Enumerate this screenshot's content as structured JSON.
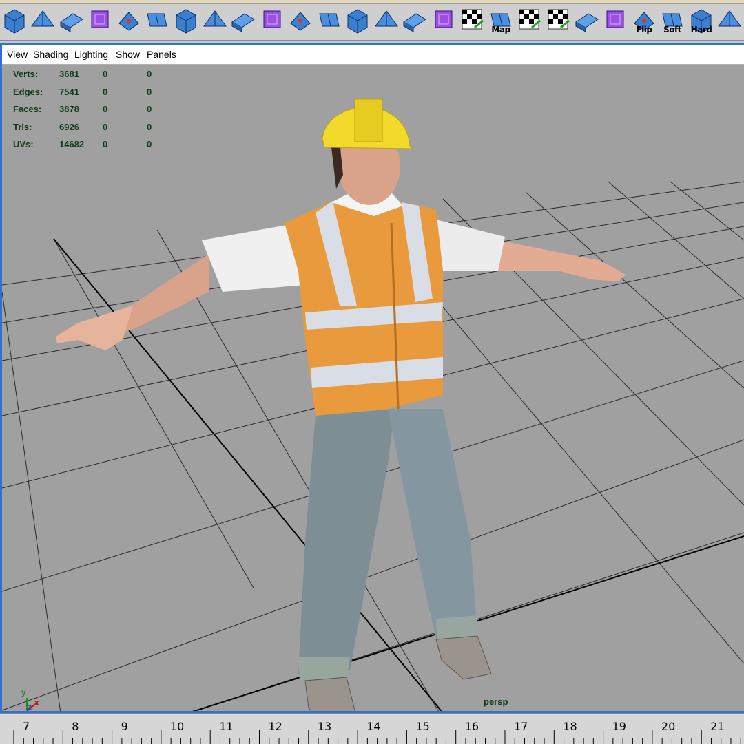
{
  "shelf": {
    "tools": [
      {
        "icon": "poly-cube-icon",
        "label": ""
      },
      {
        "icon": "poly-cube-select-icon",
        "label": ""
      },
      {
        "icon": "poly-cube-wire-icon",
        "label": ""
      },
      {
        "icon": "plane-pyramid-icon",
        "label": ""
      },
      {
        "icon": "select-face-icon",
        "label": ""
      },
      {
        "icon": "extrude-face-icon",
        "label": ""
      },
      {
        "icon": "bevel-icon",
        "label": ""
      },
      {
        "icon": "wedge-icon",
        "label": ""
      },
      {
        "icon": "split-face-icon",
        "label": ""
      },
      {
        "icon": "smooth-icon",
        "label": ""
      },
      {
        "icon": "merge-vertex-icon",
        "label": ""
      },
      {
        "icon": "cut-faces-icon",
        "label": ""
      },
      {
        "icon": "append-polygon-icon",
        "label": ""
      },
      {
        "icon": "subdivide-icon",
        "label": ""
      },
      {
        "icon": "duplicate-face-icon",
        "label": ""
      },
      {
        "icon": "move-pivot-icon",
        "label": ""
      },
      {
        "icon": "uv-checker-icon",
        "label": ""
      },
      {
        "icon": "auto-map-icon",
        "label": "Map"
      },
      {
        "icon": "uv-checker-arrow-icon",
        "label": ""
      },
      {
        "icon": "uv-checker-arrow-2-icon",
        "label": ""
      },
      {
        "icon": "uv-texture-editor-icon",
        "label": ""
      },
      {
        "icon": "uv-layout-icon",
        "label": ""
      },
      {
        "icon": "flip-normal-icon",
        "label": "Flip"
      },
      {
        "icon": "soften-edge-icon",
        "label": "Soft"
      },
      {
        "icon": "harden-edge-icon",
        "label": "Hard"
      },
      {
        "icon": "polygon-plane-icon",
        "label": ""
      }
    ]
  },
  "panel_menu": {
    "items": [
      "View",
      "Shading",
      "Lighting",
      "Show",
      "Panels"
    ]
  },
  "hud": {
    "rows": [
      {
        "label": "Verts:",
        "values": [
          "3681",
          "0",
          "0"
        ]
      },
      {
        "label": "Edges:",
        "values": [
          "7541",
          "0",
          "0"
        ]
      },
      {
        "label": "Faces:",
        "values": [
          "3878",
          "0",
          "0"
        ]
      },
      {
        "label": "Tris:",
        "values": [
          "6926",
          "0",
          "0"
        ]
      },
      {
        "label": "UVs:",
        "values": [
          "14682",
          "0",
          "0"
        ]
      }
    ]
  },
  "viewport": {
    "camera_name": "persp",
    "axis_labels": {
      "y": "y",
      "z": "z",
      "x": "x"
    },
    "background": "#a0a0a0",
    "grid_color": "#1a1a1a"
  },
  "timeline": {
    "ticks": [
      "7",
      "8",
      "9",
      "10",
      "11",
      "12",
      "13",
      "14",
      "15",
      "16",
      "17",
      "18",
      "19",
      "20",
      "21"
    ]
  },
  "colors": {
    "panel_border": "#2e6fd8",
    "hud_text": "#0b3d14",
    "vest": "#e89a3c",
    "helmet": "#f2d92a"
  }
}
